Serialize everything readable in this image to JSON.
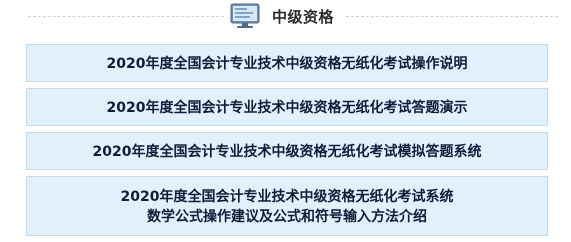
{
  "section": {
    "title": "中级资格",
    "icon": "computer-monitor-icon"
  },
  "links": [
    {
      "label": "2020年度全国会计专业技术中级资格无纸化考试操作说明"
    },
    {
      "label": "2020年度全国会计专业技术中级资格无纸化考试答题演示"
    },
    {
      "label": "2020年度全国会计专业技术中级资格无纸化考试模拟答题系统"
    },
    {
      "line1": "2020年度全国会计专业技术中级资格无纸化考试系统",
      "line2": "数学公式操作建议及公式和符号输入方法介绍"
    }
  ],
  "colors": {
    "item_background": "#e2f0fb",
    "item_border": "#c4dcef",
    "item_text": "#111c3a"
  }
}
